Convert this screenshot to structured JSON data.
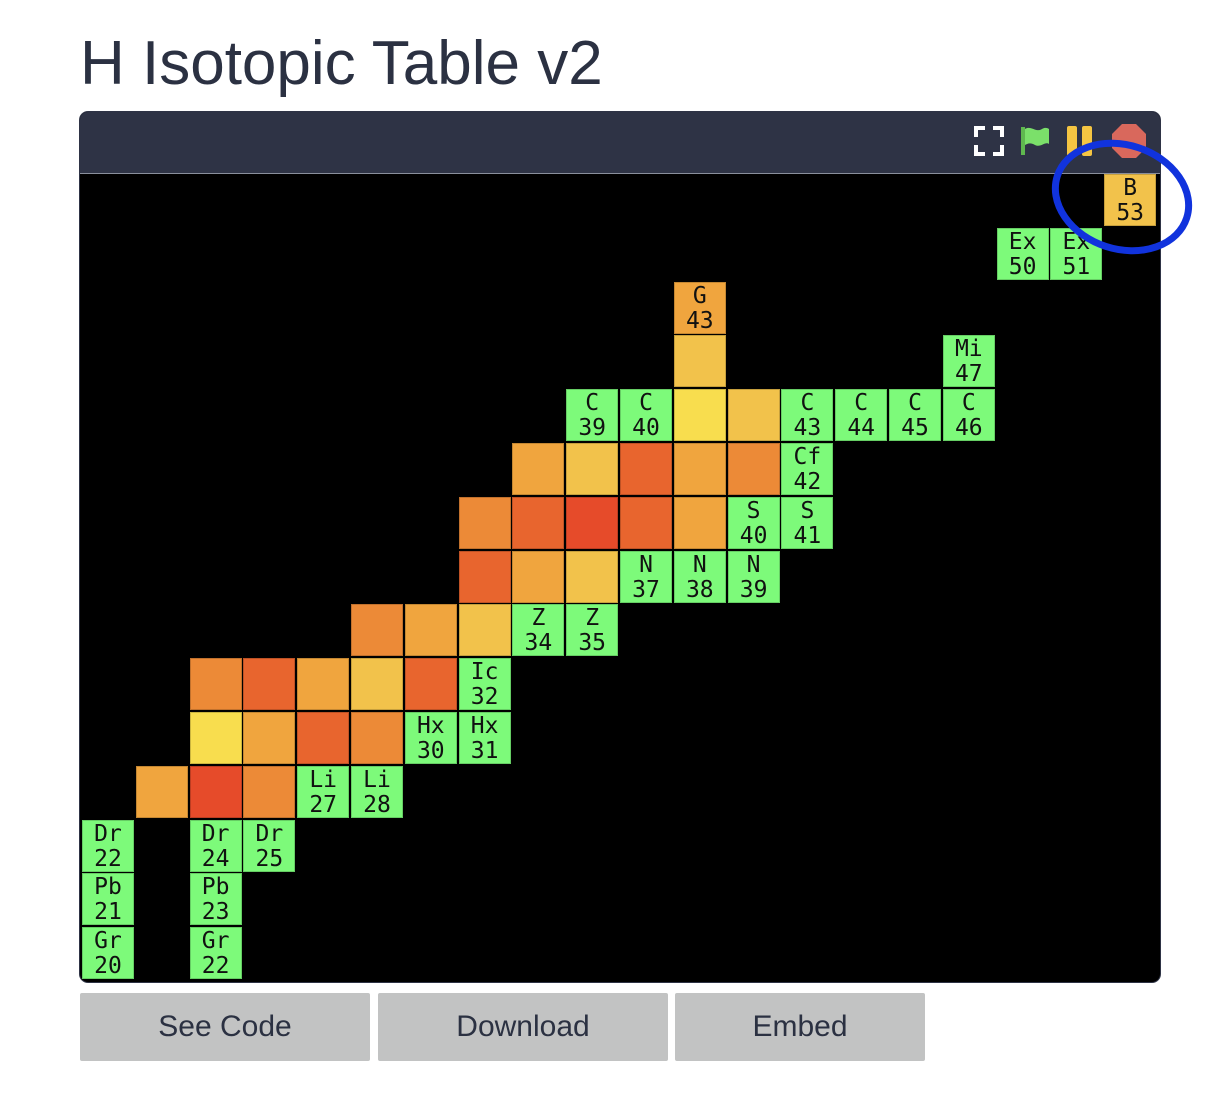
{
  "title": "H Isotopic Table v2",
  "controls": [
    {
      "name": "fullscreen-icon",
      "color": "#ffffff"
    },
    {
      "name": "green-flag-icon",
      "color": "#7be06a"
    },
    {
      "name": "pause-icon",
      "color": "#f5c542"
    },
    {
      "name": "stop-icon",
      "color": "#d9685c"
    }
  ],
  "highlight_color": "#1133dd",
  "palette": {
    "green": "#7dfa7a",
    "yellow": "#f8dd4e",
    "light_orange": "#f2c24b",
    "orange": "#f0a53e",
    "dark_orange": "#ec8a37",
    "red_orange": "#e8652e",
    "red": "#e64b2a"
  },
  "grid": {
    "rows": [
      {
        "cells": [
          {
            "col": 19,
            "sym": "B",
            "num": "53",
            "color": "light_orange"
          }
        ]
      },
      {
        "cells": [
          {
            "col": 17,
            "sym": "Ex",
            "num": "50",
            "color": "green"
          },
          {
            "col": 18,
            "sym": "Ex",
            "num": "51",
            "color": "green"
          }
        ]
      },
      {
        "cells": [
          {
            "col": 11,
            "sym": "G",
            "num": "43",
            "color": "orange"
          }
        ]
      },
      {
        "cells": [
          {
            "col": 11,
            "sym": "",
            "num": "",
            "color": "light_orange"
          },
          {
            "col": 16,
            "sym": "Mi",
            "num": "47",
            "color": "green"
          }
        ]
      },
      {
        "cells": [
          {
            "col": 9,
            "sym": "C",
            "num": "39",
            "color": "green"
          },
          {
            "col": 10,
            "sym": "C",
            "num": "40",
            "color": "green"
          },
          {
            "col": 11,
            "sym": "",
            "num": "",
            "color": "yellow"
          },
          {
            "col": 12,
            "sym": "",
            "num": "",
            "color": "light_orange"
          },
          {
            "col": 13,
            "sym": "C",
            "num": "43",
            "color": "green"
          },
          {
            "col": 14,
            "sym": "C",
            "num": "44",
            "color": "green"
          },
          {
            "col": 15,
            "sym": "C",
            "num": "45",
            "color": "green"
          },
          {
            "col": 16,
            "sym": "C",
            "num": "46",
            "color": "green"
          }
        ]
      },
      {
        "cells": [
          {
            "col": 8,
            "sym": "",
            "num": "",
            "color": "orange"
          },
          {
            "col": 9,
            "sym": "",
            "num": "",
            "color": "light_orange"
          },
          {
            "col": 10,
            "sym": "",
            "num": "",
            "color": "red_orange"
          },
          {
            "col": 11,
            "sym": "",
            "num": "",
            "color": "orange"
          },
          {
            "col": 12,
            "sym": "",
            "num": "",
            "color": "dark_orange"
          },
          {
            "col": 13,
            "sym": "Cf",
            "num": "42",
            "color": "green"
          }
        ]
      },
      {
        "cells": [
          {
            "col": 7,
            "sym": "",
            "num": "",
            "color": "dark_orange"
          },
          {
            "col": 8,
            "sym": "",
            "num": "",
            "color": "red_orange"
          },
          {
            "col": 9,
            "sym": "",
            "num": "",
            "color": "red"
          },
          {
            "col": 10,
            "sym": "",
            "num": "",
            "color": "red_orange"
          },
          {
            "col": 11,
            "sym": "",
            "num": "",
            "color": "orange"
          },
          {
            "col": 12,
            "sym": "S",
            "num": "40",
            "color": "green"
          },
          {
            "col": 13,
            "sym": "S",
            "num": "41",
            "color": "green"
          }
        ]
      },
      {
        "cells": [
          {
            "col": 7,
            "sym": "",
            "num": "",
            "color": "red_orange"
          },
          {
            "col": 8,
            "sym": "",
            "num": "",
            "color": "orange"
          },
          {
            "col": 9,
            "sym": "",
            "num": "",
            "color": "light_orange"
          },
          {
            "col": 10,
            "sym": "N",
            "num": "37",
            "color": "green"
          },
          {
            "col": 11,
            "sym": "N",
            "num": "38",
            "color": "green"
          },
          {
            "col": 12,
            "sym": "N",
            "num": "39",
            "color": "green"
          }
        ]
      },
      {
        "cells": [
          {
            "col": 5,
            "sym": "",
            "num": "",
            "color": "dark_orange"
          },
          {
            "col": 6,
            "sym": "",
            "num": "",
            "color": "orange"
          },
          {
            "col": 7,
            "sym": "",
            "num": "",
            "color": "light_orange"
          },
          {
            "col": 8,
            "sym": "Z",
            "num": "34",
            "color": "green"
          },
          {
            "col": 9,
            "sym": "Z",
            "num": "35",
            "color": "green"
          }
        ]
      },
      {
        "cells": [
          {
            "col": 2,
            "sym": "",
            "num": "",
            "color": "dark_orange"
          },
          {
            "col": 3,
            "sym": "",
            "num": "",
            "color": "red_orange"
          },
          {
            "col": 4,
            "sym": "",
            "num": "",
            "color": "orange"
          },
          {
            "col": 5,
            "sym": "",
            "num": "",
            "color": "light_orange"
          },
          {
            "col": 6,
            "sym": "",
            "num": "",
            "color": "red_orange"
          },
          {
            "col": 7,
            "sym": "Ic",
            "num": "32",
            "color": "green"
          }
        ]
      },
      {
        "cells": [
          {
            "col": 2,
            "sym": "",
            "num": "",
            "color": "yellow"
          },
          {
            "col": 3,
            "sym": "",
            "num": "",
            "color": "orange"
          },
          {
            "col": 4,
            "sym": "",
            "num": "",
            "color": "red_orange"
          },
          {
            "col": 5,
            "sym": "",
            "num": "",
            "color": "dark_orange"
          },
          {
            "col": 6,
            "sym": "Hx",
            "num": "30",
            "color": "green"
          },
          {
            "col": 7,
            "sym": "Hx",
            "num": "31",
            "color": "green"
          }
        ]
      },
      {
        "cells": [
          {
            "col": 1,
            "sym": "",
            "num": "",
            "color": "orange"
          },
          {
            "col": 2,
            "sym": "",
            "num": "",
            "color": "red"
          },
          {
            "col": 3,
            "sym": "",
            "num": "",
            "color": "dark_orange"
          },
          {
            "col": 4,
            "sym": "Li",
            "num": "27",
            "color": "green"
          },
          {
            "col": 5,
            "sym": "Li",
            "num": "28",
            "color": "green"
          }
        ]
      },
      {
        "cells": [
          {
            "col": 0,
            "sym": "Dr",
            "num": "22",
            "color": "green"
          },
          {
            "col": 2,
            "sym": "Dr",
            "num": "24",
            "color": "green"
          },
          {
            "col": 3,
            "sym": "Dr",
            "num": "25",
            "color": "green"
          }
        ]
      },
      {
        "cells": [
          {
            "col": 0,
            "sym": "Pb",
            "num": "21",
            "color": "green"
          },
          {
            "col": 2,
            "sym": "Pb",
            "num": "23",
            "color": "green"
          }
        ]
      },
      {
        "cells": [
          {
            "col": 0,
            "sym": "Gr",
            "num": "20",
            "color": "green"
          },
          {
            "col": 2,
            "sym": "Gr",
            "num": "22",
            "color": "green"
          }
        ]
      }
    ]
  },
  "buttons": {
    "see_code": "See Code",
    "download": "Download",
    "embed": "Embed"
  }
}
